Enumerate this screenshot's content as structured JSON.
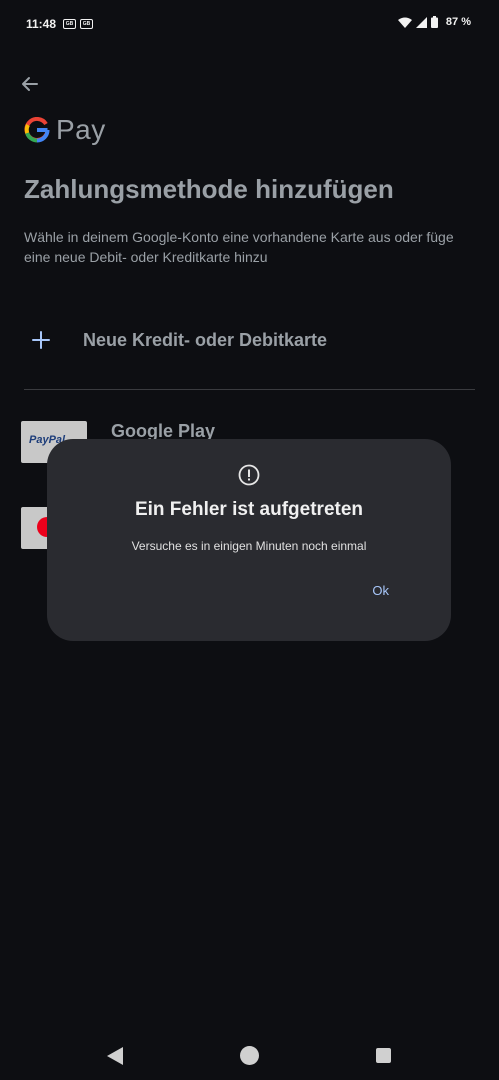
{
  "status_bar": {
    "time": "11:48",
    "badges": [
      "GB",
      "GB"
    ],
    "battery_percent": "87 %",
    "icons": [
      "wifi-icon",
      "signal-icon",
      "battery-icon"
    ]
  },
  "header": {
    "logo_text": "Pay",
    "title": "Zahlungsmethode hinzufügen",
    "subtitle": "Wähle in deinem Google-Konto eine vorhandene Karte aus oder füge eine neue Debit- oder Kreditkarte hinzu"
  },
  "add_card": {
    "label": "Neue Kredit- oder Debitkarte"
  },
  "payment_methods": [
    {
      "title": "Google Play",
      "thumb_label": "PayPal"
    },
    {
      "title": "",
      "thumb_label": ""
    }
  ],
  "dialog": {
    "title": "Ein Fehler ist aufgetreten",
    "message": "Versuche es in einigen Minuten noch einmal",
    "ok_label": "Ok"
  },
  "colors": {
    "background": "#0d0e12",
    "dialog": "#2a2b30",
    "accent": "#a8c7fa"
  }
}
